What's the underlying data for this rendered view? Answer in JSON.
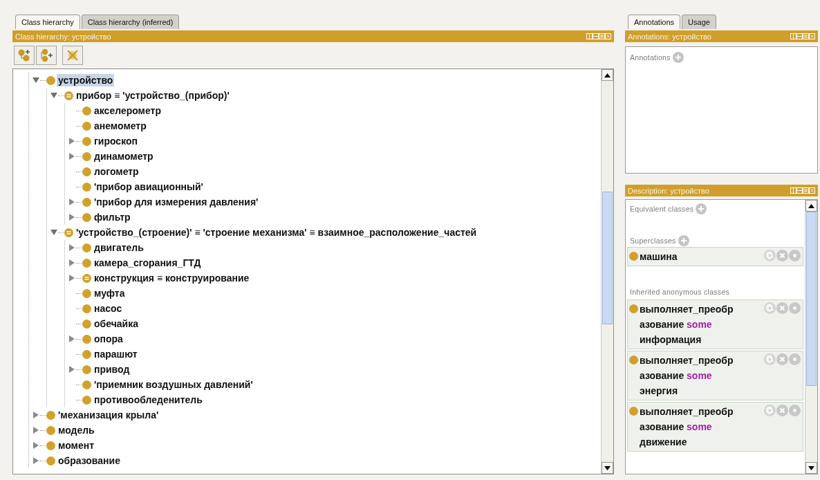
{
  "left_panel": {
    "tabs": [
      {
        "label": "Class hierarchy",
        "selected": true
      },
      {
        "label": "Class hierarchy (inferred)",
        "selected": false
      }
    ],
    "title": "Class hierarchy: устройство",
    "tree": [
      {
        "label": "устройство",
        "kind": "class",
        "expandable": true,
        "expanded": true,
        "selected": true,
        "children": [
          {
            "label": "прибор ≡ 'устройство_(прибор)'",
            "kind": "defined",
            "expandable": true,
            "expanded": true,
            "selected": false,
            "children": [
              {
                "label": "акселерометр",
                "kind": "class",
                "expandable": false,
                "selected": false
              },
              {
                "label": "анемометр",
                "kind": "class",
                "expandable": false,
                "selected": false
              },
              {
                "label": "гироскоп",
                "kind": "class",
                "expandable": true,
                "expanded": false,
                "selected": false
              },
              {
                "label": "динамометр",
                "kind": "class",
                "expandable": true,
                "expanded": false,
                "selected": false
              },
              {
                "label": "логометр",
                "kind": "class",
                "expandable": false,
                "selected": false
              },
              {
                "label": "'прибор авиационный'",
                "kind": "class",
                "expandable": false,
                "selected": false
              },
              {
                "label": "'прибор для измерения давления'",
                "kind": "class",
                "expandable": true,
                "expanded": false,
                "selected": false
              },
              {
                "label": "фильтр",
                "kind": "class",
                "expandable": true,
                "expanded": false,
                "selected": false
              }
            ]
          },
          {
            "label": "'устройство_(строение)' ≡ 'строение механизма' ≡ взаимное_расположение_частей",
            "kind": "defined",
            "expandable": true,
            "expanded": true,
            "selected": false,
            "children": [
              {
                "label": "двигатель",
                "kind": "class",
                "expandable": true,
                "expanded": false,
                "selected": false
              },
              {
                "label": "камера_сгорания_ГТД",
                "kind": "class",
                "expandable": true,
                "expanded": false,
                "selected": false
              },
              {
                "label": "конструкция ≡ конструирование",
                "kind": "defined",
                "expandable": true,
                "expanded": false,
                "selected": false
              },
              {
                "label": "муфта",
                "kind": "class",
                "expandable": false,
                "selected": false
              },
              {
                "label": "насос",
                "kind": "class",
                "expandable": false,
                "selected": false
              },
              {
                "label": "обечайка",
                "kind": "class",
                "expandable": false,
                "selected": false
              },
              {
                "label": "опора",
                "kind": "class",
                "expandable": true,
                "expanded": false,
                "selected": false
              },
              {
                "label": "парашют",
                "kind": "class",
                "expandable": false,
                "selected": false
              },
              {
                "label": "привод",
                "kind": "class",
                "expandable": true,
                "expanded": false,
                "selected": false
              },
              {
                "label": "'приемник воздушных давлений'",
                "kind": "class",
                "expandable": false,
                "selected": false
              },
              {
                "label": "противообледенитель",
                "kind": "class",
                "expandable": false,
                "selected": false
              }
            ]
          }
        ]
      },
      {
        "label": "'механизация крыла'",
        "kind": "class",
        "expandable": true,
        "expanded": false,
        "selected": false
      },
      {
        "label": "модель",
        "kind": "class",
        "expandable": true,
        "expanded": false,
        "selected": false
      },
      {
        "label": "момент",
        "kind": "class",
        "expandable": true,
        "expanded": false,
        "selected": false
      },
      {
        "label": "образование",
        "kind": "class",
        "expandable": true,
        "expanded": false,
        "selected": false
      }
    ]
  },
  "annotations_panel": {
    "tabs": [
      {
        "label": "Annotations",
        "selected": true
      },
      {
        "label": "Usage",
        "selected": false
      }
    ],
    "title": "Annotations: устройство",
    "section": "Annotations"
  },
  "description_panel": {
    "title": "Description: устройство",
    "equivalent_classes": {
      "label": "Equivalent classes"
    },
    "superclasses": {
      "label": "Superclasses",
      "items": [
        {
          "name": "машина"
        }
      ]
    },
    "inherited": {
      "label": "Inherited anonymous classes",
      "items": [
        {
          "property": "выполняет_преобразование",
          "quantifier": "some",
          "filler": "информация"
        },
        {
          "property": "выполняет_преобразование",
          "quantifier": "some",
          "filler": "энергия"
        },
        {
          "property": "выполняет_преобразование",
          "quantifier": "some",
          "filler": "движение"
        }
      ]
    }
  }
}
